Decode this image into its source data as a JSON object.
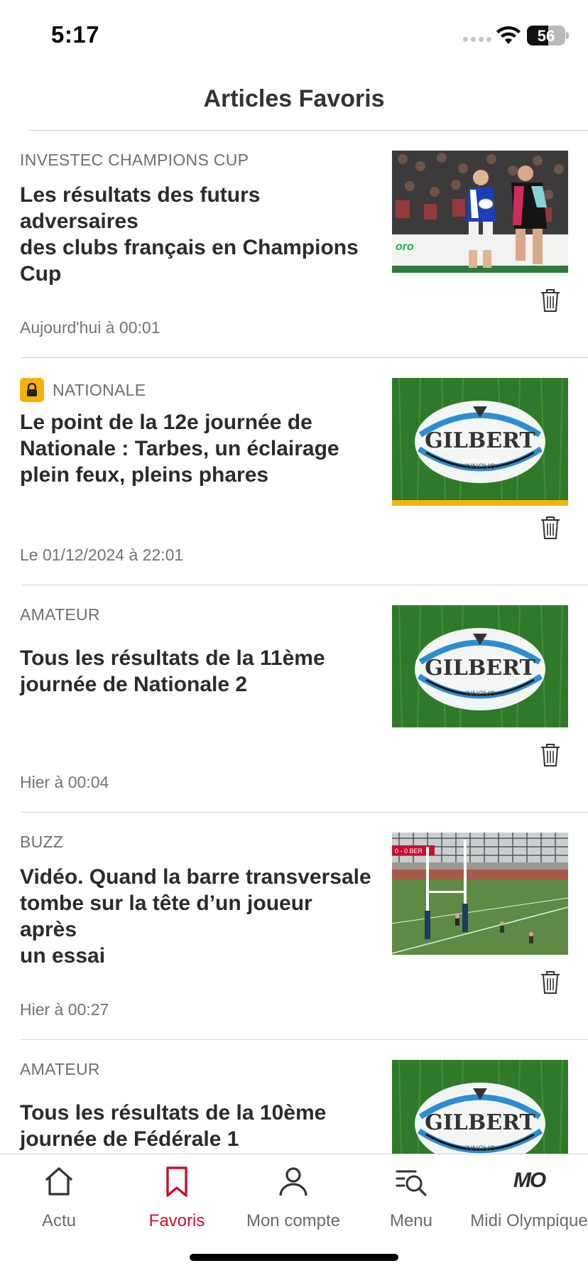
{
  "status_bar": {
    "time": "5:17",
    "battery": "56",
    "battery_level_percent": 56,
    "icons": [
      "signal-icon",
      "wifi-icon",
      "battery-icon"
    ]
  },
  "header": {
    "title": "Articles Favoris"
  },
  "articles": [
    {
      "category": "INVESTEC CHAMPIONS CUP",
      "premium": false,
      "title_lines": [
        "Les résultats des futurs adversaires",
        "des clubs français en Champions",
        "Cup"
      ],
      "date": "Aujourd'hui à 00:01",
      "image": "rugby-match-photo"
    },
    {
      "category": "NATIONALE",
      "premium": true,
      "title_lines": [
        "Le point de la 12e journée de",
        "Nationale : Tarbes, un éclairage",
        "plein feux, pleins phares"
      ],
      "date": "Le 01/12/2024 à 22:01",
      "image": "rugby-ball-photo",
      "ball_brand": "GILBERT"
    },
    {
      "category": "AMATEUR",
      "premium": false,
      "title_lines": [
        "Tous les résultats de la 11ème",
        "journée de Nationale 2"
      ],
      "date": "Hier à 00:04",
      "image": "rugby-ball-photo",
      "ball_brand": "GILBERT"
    },
    {
      "category": "BUZZ",
      "premium": false,
      "title_lines": [
        "Vidéo. Quand la barre transversale",
        "tombe sur la tête d’un joueur après",
        "un essai"
      ],
      "date": "Hier à 00:27",
      "image": "rugby-posts-photo"
    },
    {
      "category": "AMATEUR",
      "premium": false,
      "title_lines": [
        "Tous les résultats de la 10ème",
        "journée de Fédérale 1"
      ],
      "date": "",
      "image": "rugby-ball-photo",
      "ball_brand": "GILBERT"
    }
  ],
  "tabbar": {
    "tabs": [
      {
        "label": "Actu",
        "icon": "home-icon"
      },
      {
        "label": "Favoris",
        "icon": "bookmark-icon",
        "active": true
      },
      {
        "label": "Mon compte",
        "icon": "user-icon"
      },
      {
        "label": "Menu",
        "icon": "menu-search-icon"
      },
      {
        "label": "Midi Olympique",
        "icon": "mo-logo-icon",
        "logo_text": "MO"
      }
    ]
  },
  "colors": {
    "accent": "#c8102e",
    "premium": "#f5b30a",
    "text": "#2b2b2b",
    "muted": "#6f6f6f"
  }
}
